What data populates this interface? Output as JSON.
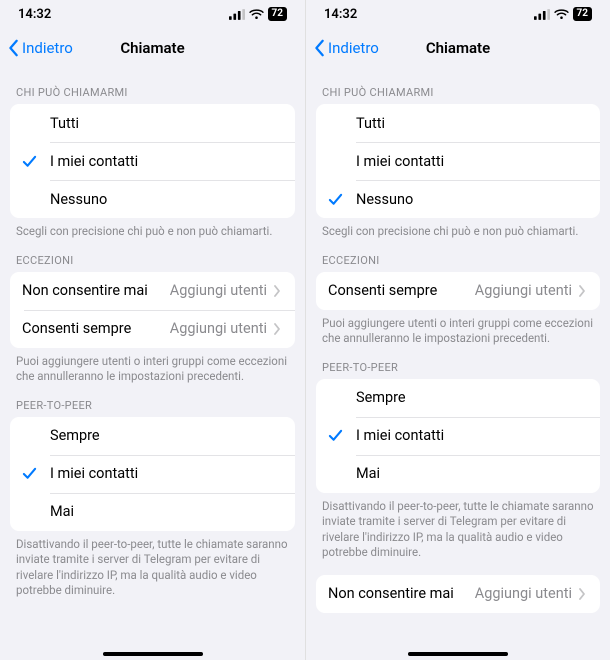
{
  "phones": [
    {
      "status": {
        "time": "14:32",
        "battery": "72"
      },
      "nav": {
        "back": "Indietro",
        "title": "Chiamate"
      },
      "sections": [
        {
          "header": "CHI PUÒ CHIAMARMI",
          "type": "radio",
          "items": [
            {
              "label": "Tutti",
              "selected": false
            },
            {
              "label": "I miei contatti",
              "selected": true
            },
            {
              "label": "Nessuno",
              "selected": false
            }
          ],
          "footer": "Scegli con precisione chi può e non può chiamarti."
        },
        {
          "header": "ECCEZIONI",
          "type": "nav",
          "items": [
            {
              "label": "Non consentire mai",
              "value": "Aggiungi utenti"
            },
            {
              "label": "Consenti sempre",
              "value": "Aggiungi utenti"
            }
          ],
          "footer": "Puoi aggiungere utenti o interi gruppi come eccezioni che annulleranno le impostazioni precedenti."
        },
        {
          "header": "PEER-TO-PEER",
          "type": "radio",
          "items": [
            {
              "label": "Sempre",
              "selected": false
            },
            {
              "label": "I miei contatti",
              "selected": true
            },
            {
              "label": "Mai",
              "selected": false
            }
          ],
          "footer": "Disattivando il peer-to-peer, tutte le chiamate saranno inviate tramite i server di Telegram per evitare di rivelare l'indirizzo IP, ma la qualità audio e video potrebbe diminuire."
        }
      ]
    },
    {
      "status": {
        "time": "14:32",
        "battery": "72"
      },
      "nav": {
        "back": "Indietro",
        "title": "Chiamate"
      },
      "sections": [
        {
          "header": "CHI PUÒ CHIAMARMI",
          "type": "radio",
          "items": [
            {
              "label": "Tutti",
              "selected": false
            },
            {
              "label": "I miei contatti",
              "selected": false
            },
            {
              "label": "Nessuno",
              "selected": true
            }
          ],
          "footer": "Scegli con precisione chi può e non può chiamarti."
        },
        {
          "header": "ECCEZIONI",
          "type": "nav",
          "items": [
            {
              "label": "Consenti sempre",
              "value": "Aggiungi utenti"
            }
          ],
          "footer": "Puoi aggiungere utenti o interi gruppi come eccezioni che annulleranno le impostazioni precedenti."
        },
        {
          "header": "PEER-TO-PEER",
          "type": "radio",
          "items": [
            {
              "label": "Sempre",
              "selected": false
            },
            {
              "label": "I miei contatti",
              "selected": true
            },
            {
              "label": "Mai",
              "selected": false
            }
          ],
          "footer": "Disattivando il peer-to-peer, tutte le chiamate saranno inviate tramite i server di Telegram per evitare di rivelare l'indirizzo IP, ma la qualità audio e video potrebbe diminuire."
        },
        {
          "header": "",
          "type": "nav",
          "items": [
            {
              "label": "Non consentire mai",
              "value": "Aggiungi utenti"
            }
          ],
          "footer": ""
        }
      ]
    }
  ]
}
